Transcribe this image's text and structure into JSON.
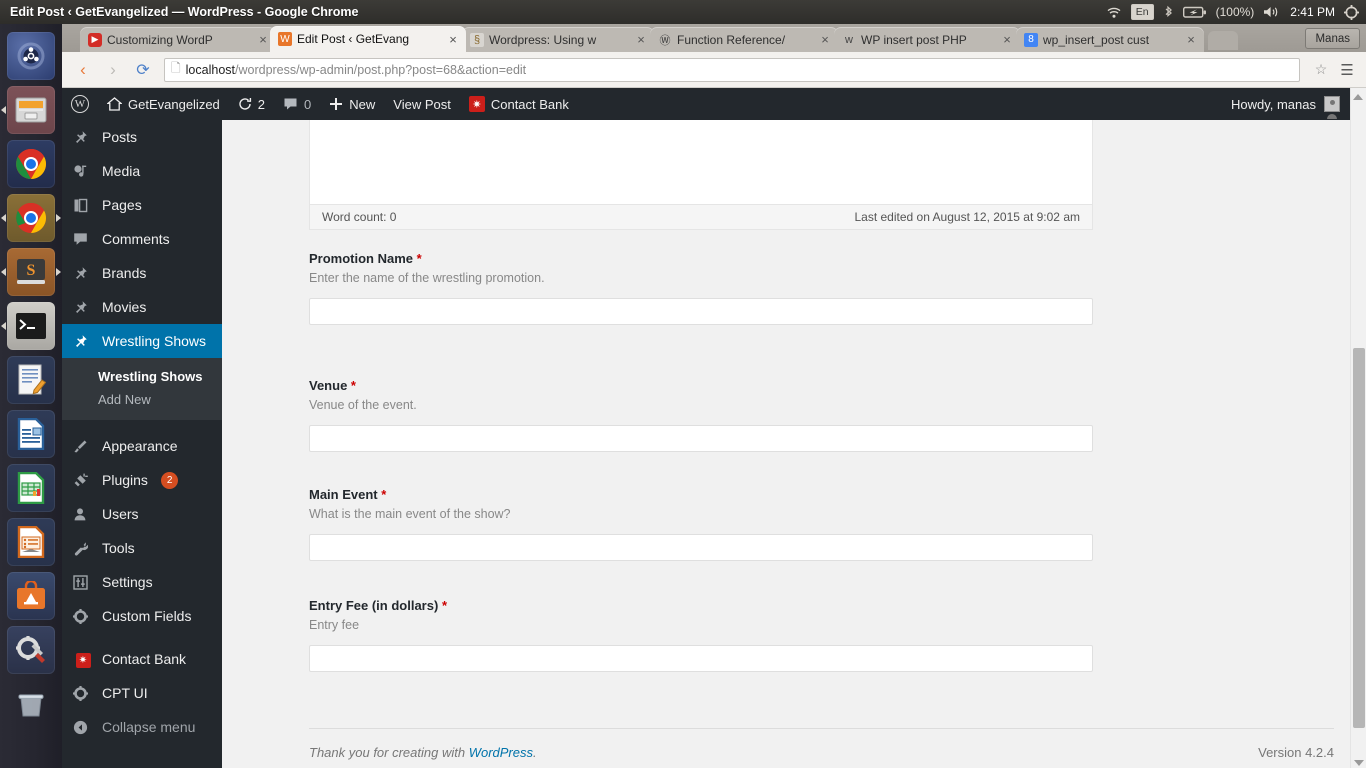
{
  "system": {
    "window_title": "Edit Post ‹ GetEvangelized — WordPress - Google Chrome",
    "indicators": {
      "wifi": "wifi-icon",
      "keyboard_layout": "En",
      "bluetooth": "bluetooth-icon",
      "battery": "battery-icon",
      "battery_percent": "(100%)",
      "volume": "volume-icon",
      "clock": "2:41 PM",
      "session": "gear-icon"
    }
  },
  "launcher": {
    "items": [
      {
        "name": "ubuntu-dash-icon",
        "label": "Dash home"
      },
      {
        "name": "files-icon",
        "label": "Files"
      },
      {
        "name": "chrome-icon",
        "label": "Google Chrome"
      },
      {
        "name": "chrome-canary-icon",
        "label": "Google Chrome"
      },
      {
        "name": "sublime-text-icon",
        "label": "Sublime Text"
      },
      {
        "name": "terminal-icon",
        "label": "Terminal"
      },
      {
        "name": "text-editor-icon",
        "label": "Text Editor"
      },
      {
        "name": "libreoffice-writer-icon",
        "label": "LibreOffice Writer"
      },
      {
        "name": "libreoffice-calc-icon",
        "label": "LibreOffice Calc"
      },
      {
        "name": "libreoffice-impress-icon",
        "label": "LibreOffice Impress"
      },
      {
        "name": "ubuntu-software-icon",
        "label": "Ubuntu Software Center"
      },
      {
        "name": "system-settings-icon",
        "label": "System Settings"
      },
      {
        "name": "trash-icon",
        "label": "Trash"
      }
    ]
  },
  "browser": {
    "tabs": [
      {
        "title": "Customizing WordP",
        "favicon": "youtube-icon",
        "active": false
      },
      {
        "title": "Edit Post ‹ GetEvang",
        "favicon": "wordpress-orange-icon",
        "active": true
      },
      {
        "title": "Wordpress: Using w",
        "favicon": "stackexchange-icon",
        "active": false
      },
      {
        "title": "Function Reference/",
        "favicon": "wordpress-icon",
        "active": false
      },
      {
        "title": "WP insert post PHP",
        "favicon": "w-icon",
        "active": false
      },
      {
        "title": "wp_insert_post cust",
        "favicon": "google-icon",
        "active": false
      }
    ],
    "close_glyph": "×",
    "profile_button": "Manas",
    "back_glyph": "‹",
    "forward_glyph": "›",
    "reload_glyph": "⟳",
    "url_bold": "localhost",
    "url_rest": "/wordpress/wp-admin/post.php?post=68&action=edit",
    "star_glyph": "☆",
    "menu_glyph": "☰"
  },
  "adminbar": {
    "logo": "wordpress-logo-icon",
    "site_name": "GetEvangelized",
    "updates_count": "2",
    "comments_count": "0",
    "new_label": "New",
    "view_post_label": "View Post",
    "contact_bank_label": "Contact Bank",
    "howdy": "Howdy, manas"
  },
  "adminmenu": {
    "items": [
      {
        "label": "Posts",
        "icon": "pin-icon",
        "current": false
      },
      {
        "label": "Media",
        "icon": "media-icon",
        "current": false
      },
      {
        "label": "Pages",
        "icon": "pages-icon",
        "current": false
      },
      {
        "label": "Comments",
        "icon": "comment-icon",
        "current": false
      },
      {
        "label": "Brands",
        "icon": "pin-icon",
        "current": false
      },
      {
        "label": "Movies",
        "icon": "pin-icon",
        "current": false
      },
      {
        "label": "Wrestling Shows",
        "icon": "pin-icon",
        "current": true
      }
    ],
    "submenu": [
      {
        "label": "Wrestling Shows",
        "current": true
      },
      {
        "label": "Add New",
        "current": false
      }
    ],
    "items2": [
      {
        "label": "Appearance",
        "icon": "brush-icon",
        "badge": ""
      },
      {
        "label": "Plugins",
        "icon": "plug-icon",
        "badge": "2"
      },
      {
        "label": "Users",
        "icon": "user-icon",
        "badge": ""
      },
      {
        "label": "Tools",
        "icon": "wrench-icon",
        "badge": ""
      },
      {
        "label": "Settings",
        "icon": "sliders-icon",
        "badge": ""
      },
      {
        "label": "Custom Fields",
        "icon": "gear-icon",
        "badge": ""
      }
    ],
    "items3": [
      {
        "label": "Contact Bank",
        "icon": "contact-bank-gear-icon"
      },
      {
        "label": "CPT UI",
        "icon": "gear-icon"
      }
    ],
    "collapse_label": "Collapse menu",
    "collapse_icon": "collapse-arrow-icon"
  },
  "editor": {
    "word_count_label": "Word count: 0",
    "last_edited": "Last edited on August 12, 2015 at 9:02 am"
  },
  "metaboxes": [
    {
      "title": "Promotion Name",
      "required": "*",
      "description": "Enter the name of the wrestling promotion.",
      "value": "",
      "placeholder": ""
    },
    {
      "title": "Venue",
      "required": "*",
      "description": "Venue of the event.",
      "value": "",
      "placeholder": ""
    },
    {
      "title": "Main Event",
      "required": "*",
      "description": "What is the main event of the show?",
      "value": "",
      "placeholder": ""
    },
    {
      "title": "Entry Fee (in dollars)",
      "required": "*",
      "description": "Entry fee",
      "value": "",
      "placeholder": ""
    }
  ],
  "footer": {
    "thanks_prefix": "Thank you for creating with ",
    "wordpress_link": "WordPress",
    "thanks_suffix": ".",
    "version": "Version 4.2.4"
  },
  "colors": {
    "wp_blue": "#0073aa",
    "admin_dark": "#23282d",
    "admin_sub": "#32373c",
    "badge_orange": "#d54e21",
    "required_red": "#c00",
    "content_bg": "#f1f1f1"
  }
}
